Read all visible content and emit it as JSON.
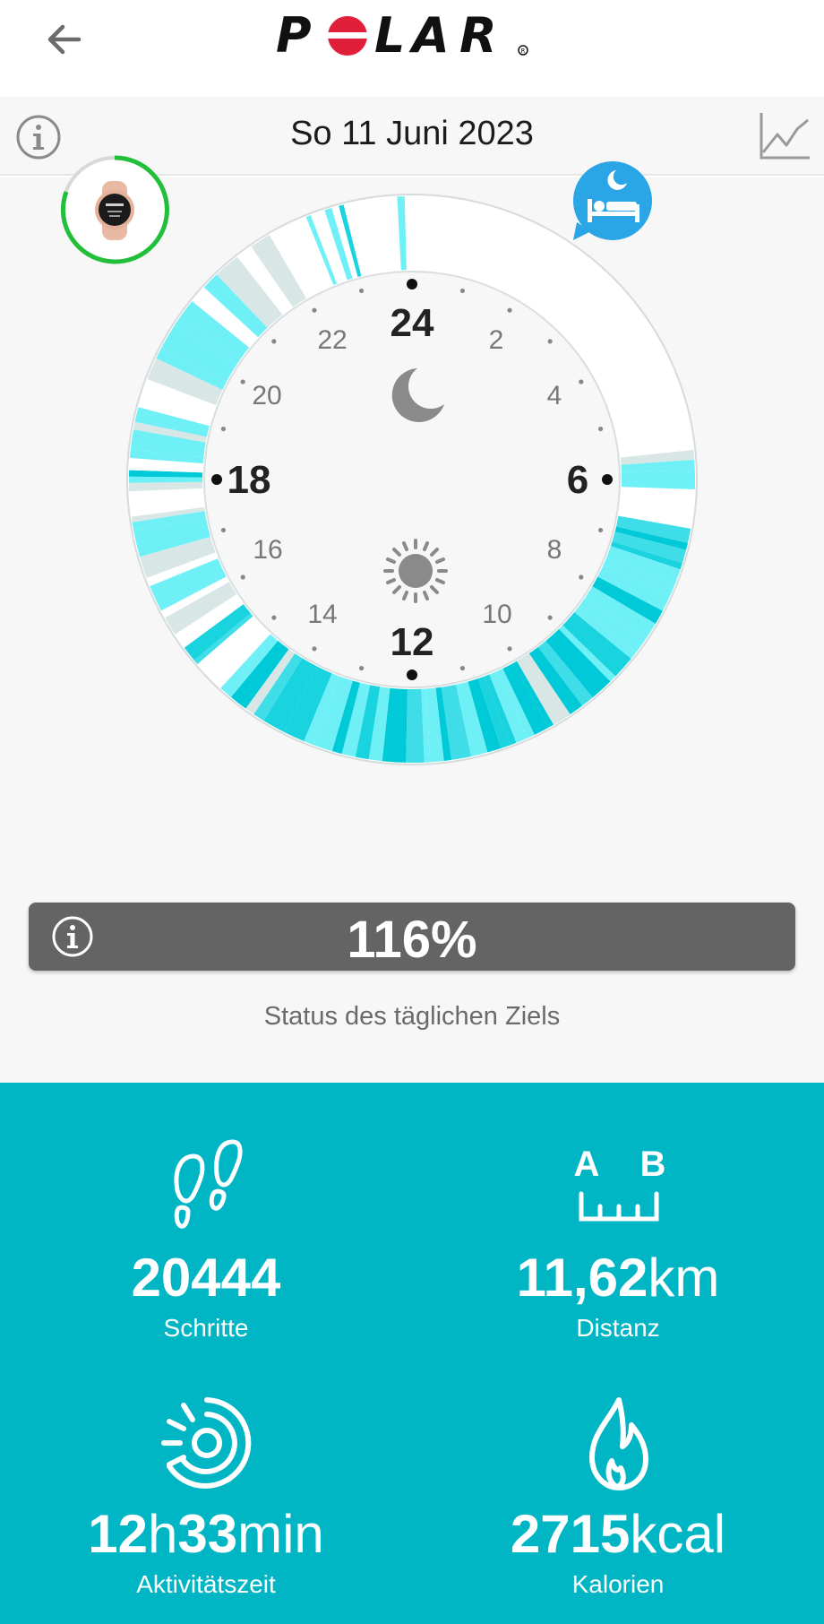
{
  "header": {
    "brand": "POLAR",
    "back_icon": "arrow-left-icon"
  },
  "datebar": {
    "date": "So 11 Juni 2023",
    "info_icon": "info-circle-icon",
    "trend_icon": "line-chart-icon"
  },
  "dial": {
    "hour_labels": {
      "h24": "24",
      "h2": "2",
      "h4": "4",
      "h6": "6",
      "h8": "8",
      "h10": "10",
      "h12": "12",
      "h14": "14",
      "h16": "16",
      "h18": "18",
      "h20": "20",
      "h22": "22"
    },
    "moon_icon": "moon-icon",
    "sun_icon": "sun-icon",
    "device_icon": "watch-icon",
    "sleep_icon": "bed-icon"
  },
  "goal": {
    "value": "116%",
    "label": "Status des täglichen Ziels",
    "progress_fraction": 1.16
  },
  "stats": {
    "steps": {
      "value": "20444",
      "label": "Schritte",
      "icon": "footprints-icon"
    },
    "distance": {
      "value": "11,62",
      "unit": "km",
      "label": "Distanz",
      "icon": "distance-ab-icon",
      "icon_a": "A",
      "icon_b": "B"
    },
    "activity": {
      "value_h": "12",
      "unit_h": "h",
      "value_m": "33",
      "unit_m": "min",
      "label": "Aktivitätszeit",
      "icon": "activity-time-icon"
    },
    "calories": {
      "value": "2715",
      "unit": "kcal",
      "label": "Kalorien",
      "icon": "flame-icon"
    }
  },
  "colors": {
    "accent": "#00b5c4",
    "ring_light": "#6ff0f7",
    "ring_mid": "#00cad8",
    "ring_gray": "#d9e6e6",
    "progress_green": "#22c03a",
    "sleep_blue": "#2aa5e6",
    "goal_bar": "#646464"
  }
}
